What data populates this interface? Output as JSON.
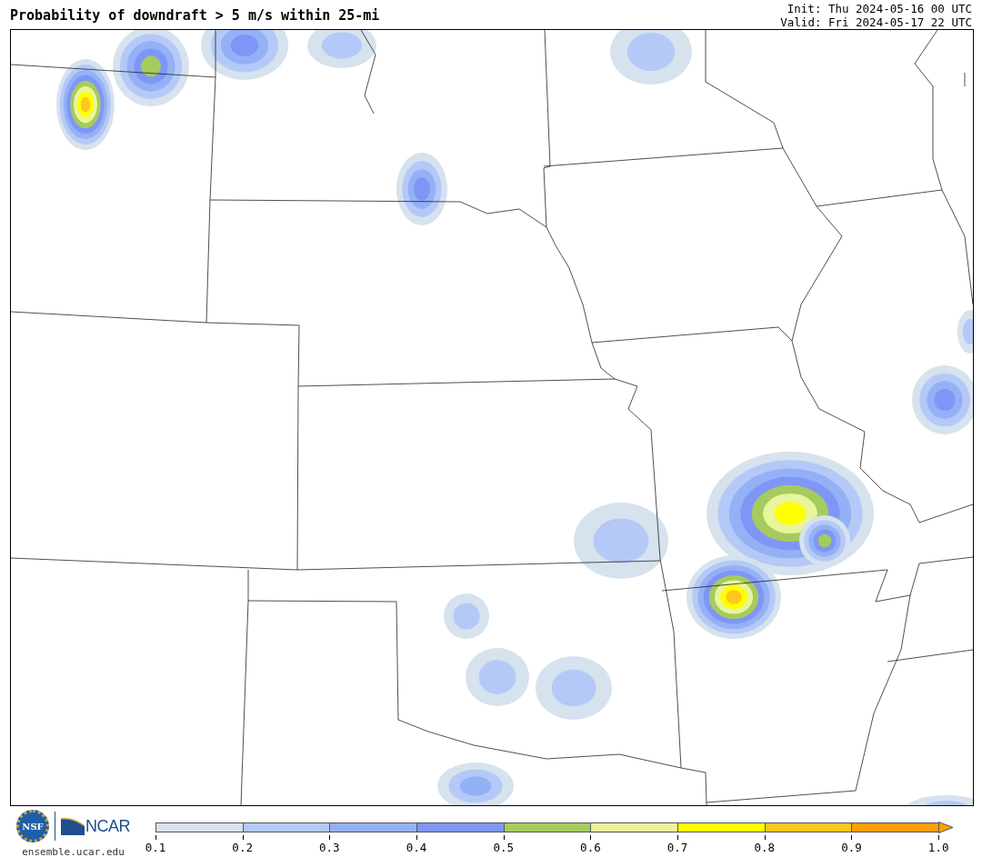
{
  "header": {
    "title": "Probability of downdraft > 5 m/s within 25-mi",
    "init": "Init: Thu 2024-05-16 00 UTC",
    "valid": "Valid: Fri 2024-05-17 22 UTC"
  },
  "footer": {
    "nsf_logo_text": "NSF",
    "ncar_logo_text": "NCAR",
    "url": "ensemble.ucar.edu"
  },
  "colorbar": {
    "bins": [
      {
        "color": "#d6e2ed"
      },
      {
        "color": "#b4c9f8"
      },
      {
        "color": "#94b1f6"
      },
      {
        "color": "#7f96f7"
      },
      {
        "color": "#a6cb5d"
      },
      {
        "color": "#e8f59c"
      },
      {
        "color": "#ffff00"
      },
      {
        "color": "#ffc61c"
      },
      {
        "color": "#ff9f08"
      }
    ],
    "extend_bin": {
      "color": "#ff9f08"
    },
    "ticks": [
      "0.1",
      "0.2",
      "0.3",
      "0.4",
      "0.5",
      "0.6",
      "0.7",
      "0.8",
      "0.9",
      "1.0"
    ]
  }
}
